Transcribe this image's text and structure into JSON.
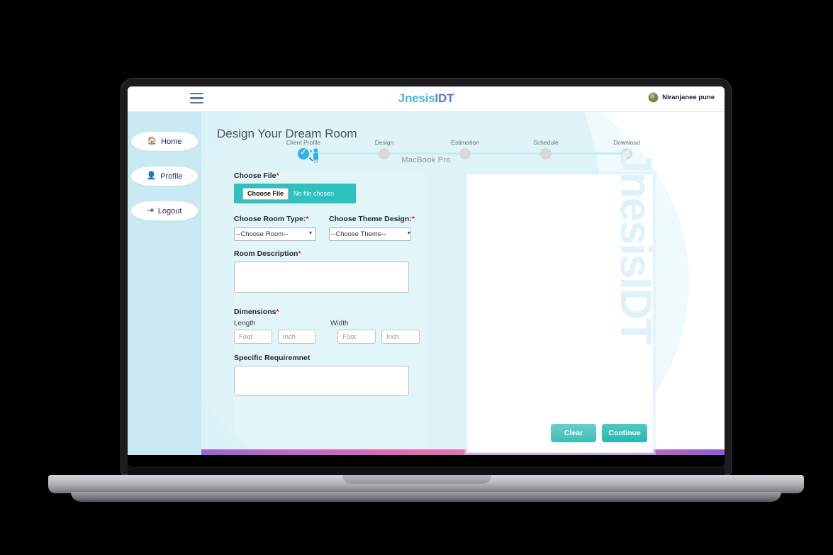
{
  "device": {
    "model_label": "MacBook Pro"
  },
  "topbar": {
    "menu_icon": "hamburger-icon",
    "brand_part1": "Jnesis",
    "brand_part2": "IDT",
    "user_name": "Niranjanee pune",
    "avatar_icon": "user-avatar"
  },
  "sidebar": {
    "items": [
      {
        "label": "Home",
        "icon": "home-icon"
      },
      {
        "label": "Profile",
        "icon": "user-icon"
      },
      {
        "label": "Logout",
        "icon": "logout-icon"
      }
    ]
  },
  "main": {
    "page_title": "Design Your Dream Room",
    "watermark": "JnesisIDT"
  },
  "stepper": {
    "steps": [
      {
        "label": "Client Profile",
        "state": "done"
      },
      {
        "label": "Design",
        "state": "pending"
      },
      {
        "label": "Estimation",
        "state": "pending"
      },
      {
        "label": "Schedule",
        "state": "pending"
      },
      {
        "label": "Download",
        "state": "pending"
      }
    ]
  },
  "form": {
    "choose_file": {
      "label": "Choose File",
      "required_mark": "*",
      "button_label": "Choose File",
      "status_text": "No file chosen"
    },
    "room_type": {
      "label": "Choose Room Type:",
      "required_mark": "*",
      "selected": "--Choose Room--",
      "caret_icon": "chevron-down-icon"
    },
    "theme_design": {
      "label": "Choose Theme Design:",
      "required_mark": "*",
      "selected": "--Choose Theme--",
      "caret_icon": "chevron-down-icon"
    },
    "room_description": {
      "label": "Room Description",
      "required_mark": "*",
      "value": ""
    },
    "dimensions": {
      "label": "Dimensions",
      "required_mark": "*",
      "length_label": "Length",
      "width_label": "Width",
      "length_foot_placeholder": "Foot",
      "length_inch_placeholder": "Inch",
      "width_foot_placeholder": "Foot",
      "width_inch_placeholder": "Inch"
    },
    "specific_requirement": {
      "label": "Specific Requiremnet",
      "value": ""
    }
  },
  "actions": {
    "clear_label": "Clear",
    "continue_label": "Continue"
  },
  "colors": {
    "accent_teal": "#2fc1bd",
    "accent_blue": "#2fb4ea",
    "sidebar_bg": "#c9eaf3",
    "brand_light": "#4ab3e8",
    "brand_dark": "#4a7fd4",
    "required_red": "#e02020"
  }
}
